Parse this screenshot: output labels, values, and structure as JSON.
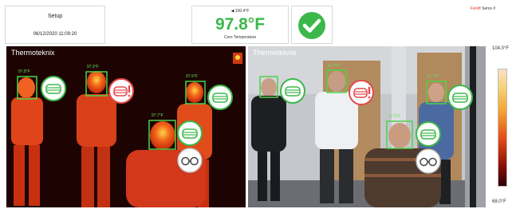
{
  "setup": {
    "title": "Setup",
    "datetime": "06/12/2020 11:09:20"
  },
  "temperature": {
    "top": "◀  100.4°F",
    "value": "97.8°F",
    "label": "Core Temperature"
  },
  "brand": {
    "name_red": "Fenítt",
    "name_rest": " Sensı #"
  },
  "thermal": {
    "label": "Thermoteknix"
  },
  "visual": {
    "label": "Thermoteknix"
  },
  "scale": {
    "max": "104.0°F",
    "min": "68.0°F"
  },
  "readings": [
    "97.8°F",
    "97.9°F",
    "97.9°F",
    "97.7°F",
    "97.7°F",
    "97.6°F"
  ],
  "colors": {
    "accent_green": "#3cb84a",
    "alert_red": "#e24b4b"
  }
}
